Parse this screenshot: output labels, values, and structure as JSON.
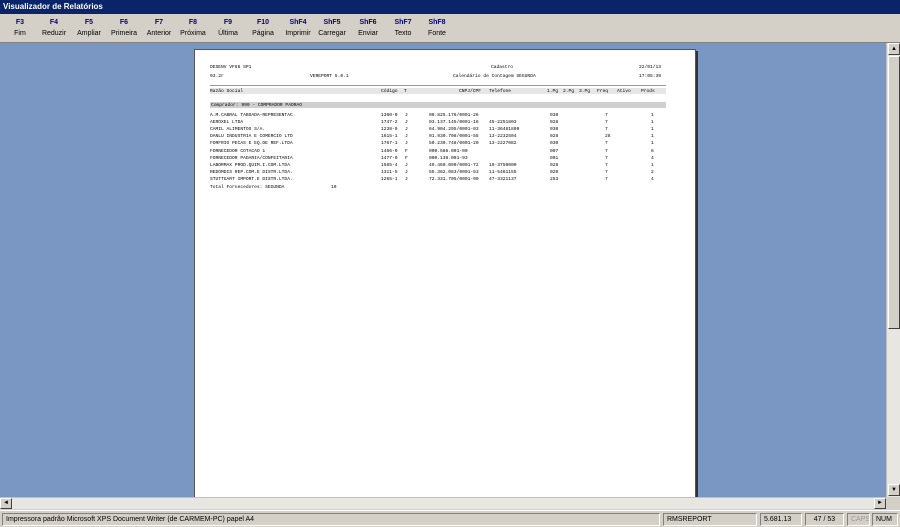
{
  "window": {
    "title": "Visualizador de Relatórios"
  },
  "toolbar": [
    {
      "key": "F3",
      "label": "Fim"
    },
    {
      "key": "F4",
      "label": "Reduzir"
    },
    {
      "key": "F5",
      "label": "Ampliar"
    },
    {
      "key": "F6",
      "label": "Primeira"
    },
    {
      "key": "F7",
      "label": "Anterior"
    },
    {
      "key": "F8",
      "label": "Próxima"
    },
    {
      "key": "F9",
      "label": "Última"
    },
    {
      "key": "F10",
      "label": "Página"
    },
    {
      "key": "ShF4",
      "label": "Imprimir"
    },
    {
      "key": "ShF5",
      "label": "Carregar"
    },
    {
      "key": "ShF6",
      "label": "Enviar"
    },
    {
      "key": "ShF7",
      "label": "Texto"
    },
    {
      "key": "ShF8",
      "label": "Fonte"
    }
  ],
  "report": {
    "system": "DESENV VF66 SP1",
    "module": "Cadastro",
    "date": "22/01/13",
    "version_code": "03.2r",
    "program": "VEREPORT 5.0.1",
    "subtitle": "Calendário de Contagem SEGUNDA",
    "time": "17:05:39",
    "columns": {
      "name": "Razão Social",
      "code": "Código",
      "type": "T",
      "doc": "CNPJ/CPF",
      "phone": "Telefone",
      "p1": "1.Pg",
      "p2": "2.Pg",
      "p3": "3.Pg",
      "freq": "Freq",
      "active": "Ativo",
      "prods": "Prods"
    },
    "group": "Comprador: 999 - COMPRADOR PADRAO",
    "rows": [
      {
        "name": "A.M.CABRAL TABOADA-REPRESENTAC",
        "code": "1360-0",
        "type": "J",
        "doc": "00.825.176/0001-26",
        "phone": "",
        "p1": "030",
        "freq": "7",
        "prods": "1"
      },
      {
        "name": "AEROXEL LTDA",
        "code": "1747-2",
        "type": "J",
        "doc": "03.137.145/0001-16",
        "phone": "45-2251803",
        "p1": "028",
        "freq": "7",
        "prods": "1"
      },
      {
        "name": "CAMIL ALIMENTOS S/A.",
        "code": "1238-9",
        "type": "J",
        "doc": "64.904.295/0001-03",
        "phone": "11-36481800",
        "p1": "030",
        "freq": "7",
        "prods": "1"
      },
      {
        "name": "DANLU INDUSTRIA E COMERCIO LTD",
        "code": "1615-1",
        "type": "J",
        "doc": "01.930.708/0001-55",
        "phone": "13-2232504",
        "p1": "028",
        "freq": "28",
        "prods": "1"
      },
      {
        "name": "FORFRIO PECAS E EQ.DE REF.LTDA",
        "code": "1767-1",
        "type": "J",
        "doc": "50.230.748/0001-20",
        "phone": "13-2227082",
        "p1": "030",
        "freq": "7",
        "prods": "1"
      },
      {
        "name": "FORNECEDOR COTACAO 1",
        "code": "1466-0",
        "type": "F",
        "doc": "000.586.001-00",
        "phone": "",
        "p1": "007",
        "freq": "7",
        "prods": "6"
      },
      {
        "name": "FORNECEDOR PADARIA/CONFEITARIA",
        "code": "1477-0",
        "type": "F",
        "doc": "000.138.001-93",
        "phone": "",
        "p1": "001",
        "freq": "7",
        "prods": "4"
      },
      {
        "name": "LABORMAX PROD.QUIM.I.COM.LTDA",
        "code": "1565-4",
        "type": "J",
        "doc": "49.460.090/0001-72",
        "phone": "19-3750000",
        "p1": "028",
        "freq": "7",
        "prods": "1"
      },
      {
        "name": "REDOMDIS REP.COM.E DISTR.LTDA.",
        "code": "1311-5",
        "type": "J",
        "doc": "55.362.083/0001-53",
        "phone": "11-5461155",
        "p1": "020",
        "freq": "7",
        "prods": "2"
      },
      {
        "name": "STUTTGART IMPORT.E DISTR.LTDA.",
        "code": "1265-1",
        "type": "J",
        "doc": "72.331.705/0001-00",
        "phone": "47-3321137",
        "p1": "253",
        "freq": "7",
        "prods": "4"
      }
    ],
    "total_label": "Total Fornecedores: SEGUNDA",
    "total_value": "10"
  },
  "statusbar": {
    "printer": "Impressora padrão Microsoft XPS Document Writer (de CARMEM-PC) papel A4",
    "report_name": "RMSREPORT",
    "version": "5.681.13",
    "page": "47 / 53",
    "caps": "CAPS",
    "num": "NUM"
  },
  "colors": {
    "titlebar": "#0a246a",
    "viewport": "#7a97c4",
    "toolbar_key": "#000080"
  }
}
